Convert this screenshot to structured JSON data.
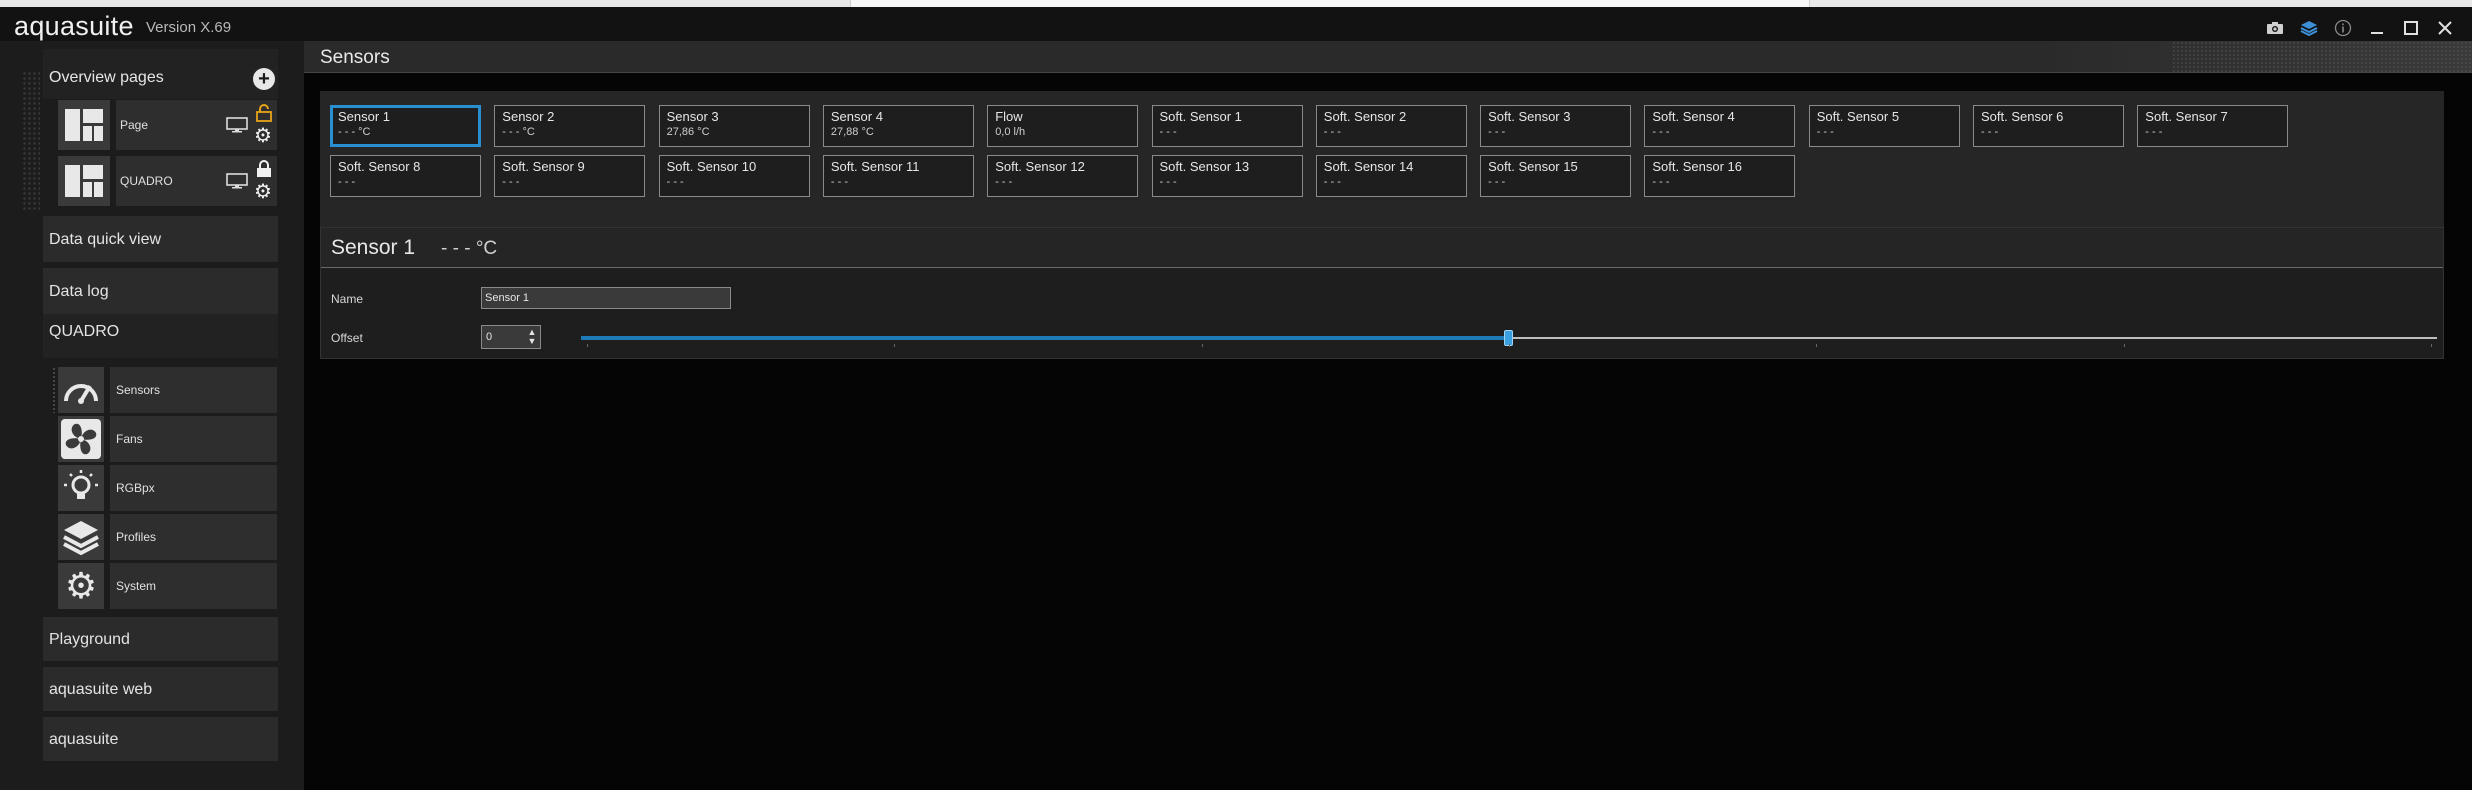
{
  "app": {
    "name": "aquasuite",
    "version": "Version X.69"
  },
  "titlebar_icons": [
    "camera-icon",
    "layers-icon",
    "info-icon",
    "minimize-icon",
    "maximize-icon",
    "close-icon"
  ],
  "sidebar": {
    "overview_label": "Overview pages",
    "pages": [
      {
        "label": "Page"
      },
      {
        "label": "QUADRO"
      }
    ],
    "data_quick_view": "Data quick view",
    "data_log": "Data log",
    "device": "QUADRO",
    "device_items": [
      {
        "label": "Sensors",
        "icon": "gauge-icon"
      },
      {
        "label": "Fans",
        "icon": "fan-icon"
      },
      {
        "label": "RGBpx",
        "icon": "lightbulb-icon"
      },
      {
        "label": "Profiles",
        "icon": "layers-icon"
      },
      {
        "label": "System",
        "icon": "gear-icon"
      }
    ],
    "playground": "Playground",
    "aquasuite_web": "aquasuite web",
    "aquasuite": "aquasuite"
  },
  "main": {
    "title": "Sensors",
    "tiles": [
      {
        "name": "Sensor 1",
        "value": "- - - °C"
      },
      {
        "name": "Sensor 2",
        "value": "- - - °C"
      },
      {
        "name": "Sensor 3",
        "value": "27,86 °C"
      },
      {
        "name": "Sensor 4",
        "value": "27,88 °C"
      },
      {
        "name": "Flow",
        "value": "0,0 l/h"
      },
      {
        "name": "Soft. Sensor 1",
        "value": "- - -"
      },
      {
        "name": "Soft. Sensor 2",
        "value": "- - -"
      },
      {
        "name": "Soft. Sensor 3",
        "value": "- - -"
      },
      {
        "name": "Soft. Sensor 4",
        "value": "- - -"
      },
      {
        "name": "Soft. Sensor 5",
        "value": "- - -"
      },
      {
        "name": "Soft. Sensor 6",
        "value": "- - -"
      },
      {
        "name": "Soft. Sensor 7",
        "value": "- - -"
      },
      {
        "name": "Soft. Sensor 8",
        "value": "- - -"
      },
      {
        "name": "Soft. Sensor 9",
        "value": "- - -"
      },
      {
        "name": "Soft. Sensor 10",
        "value": "- - -"
      },
      {
        "name": "Soft. Sensor 11",
        "value": "- - -"
      },
      {
        "name": "Soft. Sensor 12",
        "value": "- - -"
      },
      {
        "name": "Soft. Sensor 13",
        "value": "- - -"
      },
      {
        "name": "Soft. Sensor 14",
        "value": "- - -"
      },
      {
        "name": "Soft. Sensor 15",
        "value": "- - -"
      },
      {
        "name": "Soft. Sensor 16",
        "value": "- - -"
      }
    ],
    "detail": {
      "title": "Sensor 1",
      "value": "- - - °C",
      "name_label": "Name",
      "name_value": "Sensor 1",
      "offset_label": "Offset",
      "offset_value": "0",
      "offset_slider_fraction": 0.5
    }
  },
  "colors": {
    "accent": "#2a8fd0",
    "lock": "#e8a317"
  }
}
